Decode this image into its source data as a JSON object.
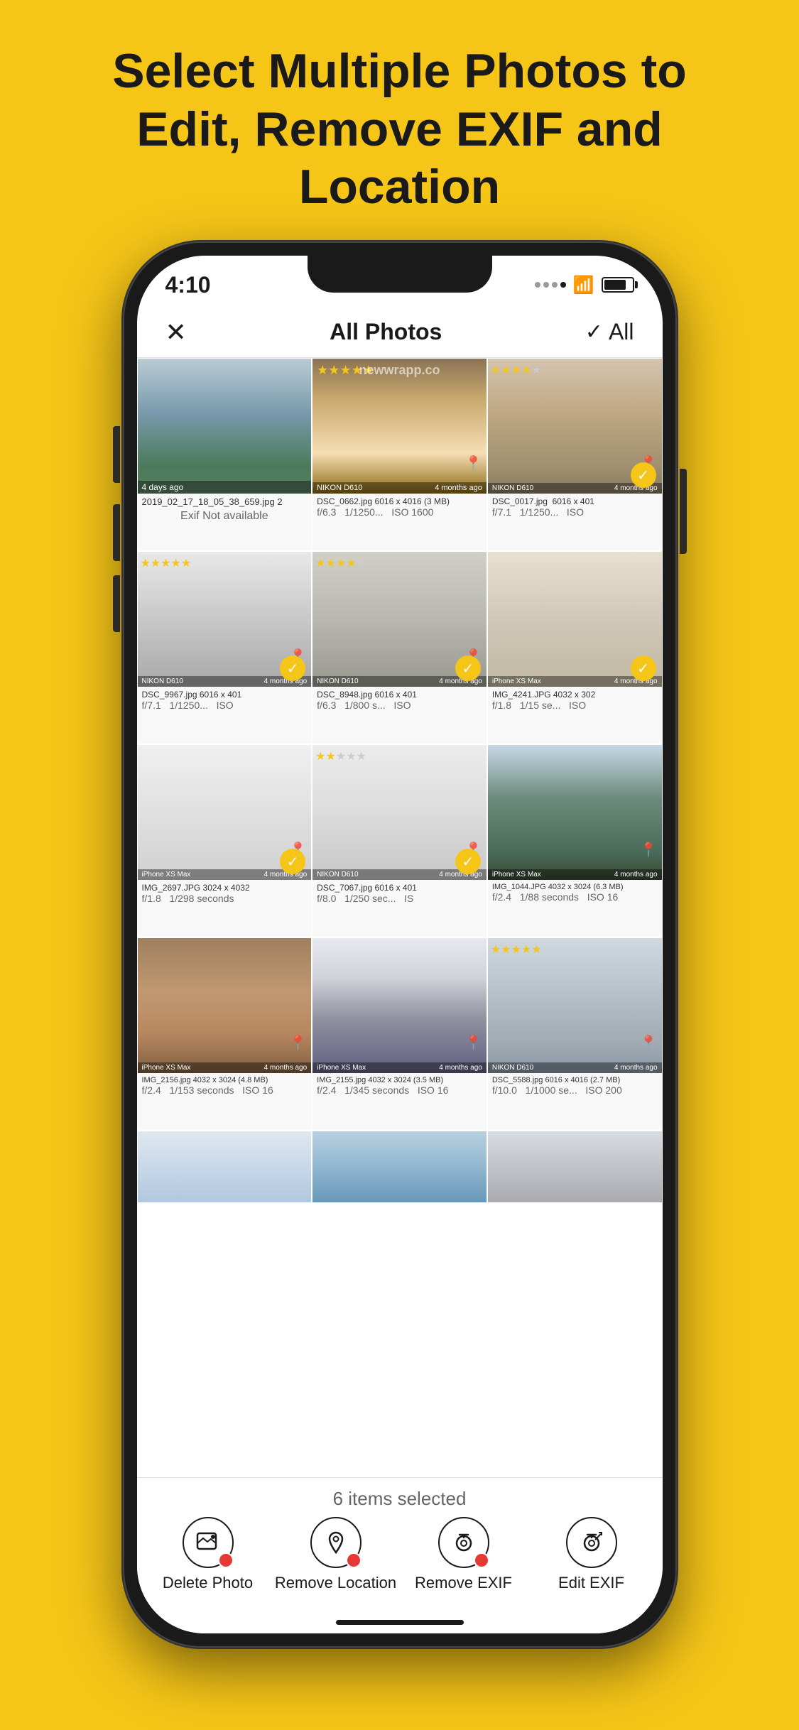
{
  "page": {
    "background_color": "#F5C518",
    "title": "Select Multiple Photos to Edit, Remove EXIF and Location"
  },
  "status_bar": {
    "time": "4:10",
    "signal": [
      "inactive",
      "inactive",
      "inactive",
      "inactive"
    ],
    "wifi": true,
    "battery": 80
  },
  "nav": {
    "close_label": "×",
    "title": "All Photos",
    "select_all": "All"
  },
  "photos": [
    {
      "row": 1,
      "cells": [
        {
          "id": "ph1",
          "theme": "ph-mountains",
          "time": "4 days ago",
          "filename": "2019_02_17_18_05_38_659.jpg 2",
          "exif": "Exif Not available",
          "stars": 0,
          "has_location": false,
          "selected": false
        },
        {
          "id": "ph2",
          "theme": "ph-tiger",
          "camera": "NIKON D610",
          "time": "4 months ago",
          "filename": "DSC_0662.jpg 6016 x 4016 (3 MB)",
          "exif": "f/6.3   1/1250...  ISO 1600",
          "stars": 5,
          "has_location": true,
          "selected": false
        },
        {
          "id": "ph3",
          "theme": "ph-hippo",
          "camera": "NIKON D610",
          "time": "4 months ago",
          "filename": "DSC_0017.jpg  6016 x 401",
          "exif": "f/7.1   1/1250...  ISO",
          "stars": 4,
          "has_location": true,
          "selected": true
        }
      ]
    },
    {
      "row": 2,
      "cells": [
        {
          "id": "ph4",
          "theme": "ph-heron",
          "camera": "NIKON D610",
          "time": "4 months ago",
          "filename": "DSC_9967.jpg 6016 x 401",
          "exif": "f/7.1   1/1250...  ISO",
          "stars": 5,
          "has_location": true,
          "selected": true
        },
        {
          "id": "ph5",
          "theme": "ph-deer",
          "camera": "NIKON D610",
          "time": "4 months ago",
          "filename": "DSC_8948.jpg 6016 x 401",
          "exif": "f/6.3   1/800 s...  ISO",
          "stars": 4,
          "has_location": true,
          "selected": true
        },
        {
          "id": "ph6",
          "theme": "ph-sandy",
          "camera": "iPhone XS Max",
          "time": "4 months ago",
          "filename": "IMG_4241.JPG 4032 x 302",
          "exif": "f/1.8   1/15 se...  ISO",
          "stars": 0,
          "has_location": false,
          "selected": true
        }
      ]
    },
    {
      "row": 3,
      "cells": [
        {
          "id": "ph7",
          "theme": "ph-trees1",
          "camera": "iPhone XS Max",
          "time": "4 months ago",
          "filename": "IMG_2697.JPG 3024 x 4032",
          "exif": "f/1.8   1/298 seconds",
          "stars": 0,
          "has_location": true,
          "selected": true
        },
        {
          "id": "ph8",
          "theme": "ph-trees2",
          "camera": "NIKON D610",
          "time": "4 months ago",
          "filename": "DSC_7067.jpg 6016 x 401",
          "exif": "f/8.0   1/250 sec...  IS",
          "stars": 2,
          "has_location": true,
          "selected": true
        },
        {
          "id": "ph9",
          "theme": "ph-pavilion",
          "camera": "iPhone XS Max",
          "time": "4 months ago",
          "filename": "IMG_1044.JPG 4032 x 3024 (6.3 MB)",
          "exif": "f/2.4   1/88 seconds  ISO 16",
          "stars": 0,
          "has_location": true,
          "selected": false
        }
      ]
    },
    {
      "row": 4,
      "cells": [
        {
          "id": "ph10",
          "theme": "ph-mansion",
          "camera": "iPhone XS Max",
          "time": "4 months ago",
          "filename": "IMG_2156.jpg 4032 x 3024 (4.8 MB)",
          "exif": "f/2.4   1/153 seconds  ISO 16",
          "stars": 0,
          "has_location": true,
          "selected": false
        },
        {
          "id": "ph11",
          "theme": "ph-chalets",
          "camera": "iPhone XS Max",
          "time": "4 months ago",
          "filename": "IMG_2155.jpg 4032 x 3024 (3.5 MB)",
          "exif": "f/2.4   1/345 seconds  ISO 16",
          "stars": 0,
          "has_location": true,
          "selected": false
        },
        {
          "id": "ph12",
          "theme": "ph-snow-person",
          "camera": "NIKON D610",
          "time": "4 months ago",
          "filename": "DSC_5588.jpg 6016 x 4016 (2.7 MB)",
          "exif": "f/10.0   1/1000 se...  ISO 200",
          "stars": 5,
          "has_location": true,
          "selected": false
        }
      ]
    },
    {
      "row": 5,
      "cells": [
        {
          "id": "ph13",
          "theme": "ph-clouds",
          "camera": "",
          "time": "",
          "filename": "",
          "exif": "",
          "stars": 0,
          "has_location": false,
          "selected": false
        },
        {
          "id": "ph14",
          "theme": "ph-river",
          "camera": "",
          "time": "",
          "filename": "",
          "exif": "",
          "stars": 0,
          "has_location": false,
          "selected": false
        },
        {
          "id": "ph15",
          "theme": "ph-misty",
          "camera": "",
          "time": "",
          "filename": "",
          "exif": "",
          "stars": 0,
          "has_location": false,
          "selected": false
        }
      ]
    }
  ],
  "bottom_bar": {
    "selected_count": "6 items selected",
    "actions": [
      {
        "id": "delete-photo",
        "label": "Delete Photo",
        "icon": "🖼",
        "has_badge": true
      },
      {
        "id": "remove-location",
        "label": "Remove Location",
        "icon": "📍",
        "has_badge": true
      },
      {
        "id": "remove-exif",
        "label": "Remove EXIF",
        "icon": "📷",
        "has_badge": true
      },
      {
        "id": "edit-exif",
        "label": "Edit EXIF",
        "icon": "📷",
        "has_badge": false
      }
    ]
  }
}
